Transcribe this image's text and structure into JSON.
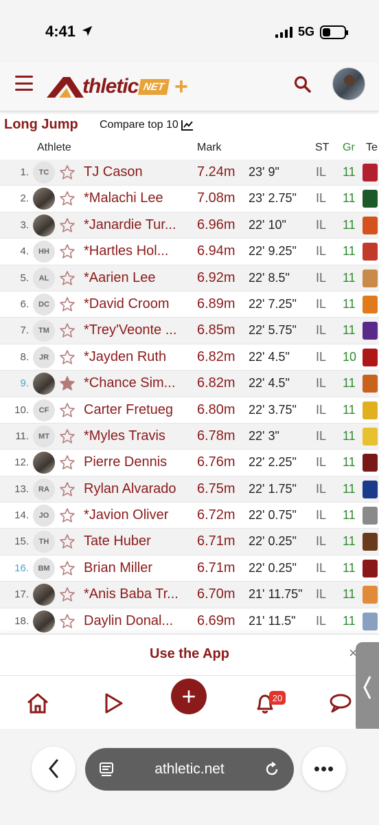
{
  "status_bar": {
    "time": "4:41",
    "network": "5G"
  },
  "header": {
    "logo_text": "thletic",
    "logo_badge": "NET"
  },
  "event": {
    "title": "Long Jump",
    "compare_label": "Compare top 10"
  },
  "columns": {
    "athlete": "Athlete",
    "mark": "Mark",
    "state": "ST",
    "grade": "Gr",
    "team": "Te"
  },
  "rows": [
    {
      "rank": "1.",
      "initials": "TC",
      "name": "TJ Cason",
      "mark": "7.24m",
      "imperial": "23' 9\"",
      "state": "IL",
      "grade": "11",
      "photo": false,
      "starred": false,
      "rank_blue": false,
      "team_color": "#b22030"
    },
    {
      "rank": "2.",
      "initials": "",
      "name": "*Malachi Lee",
      "mark": "7.08m",
      "imperial": "23' 2.75\"",
      "state": "IL",
      "grade": "11",
      "photo": true,
      "starred": false,
      "rank_blue": false,
      "team_color": "#1d5a2a"
    },
    {
      "rank": "3.",
      "initials": "",
      "name": "*Janardie Tur...",
      "mark": "6.96m",
      "imperial": "22' 10\"",
      "state": "IL",
      "grade": "11",
      "photo": true,
      "starred": false,
      "rank_blue": false,
      "team_color": "#d4521c"
    },
    {
      "rank": "4.",
      "initials": "HH",
      "name": "*Hartles Hol...",
      "mark": "6.94m",
      "imperial": "22' 9.25\"",
      "state": "IL",
      "grade": "11",
      "photo": false,
      "starred": false,
      "rank_blue": false,
      "team_color": "#c23a2a"
    },
    {
      "rank": "5.",
      "initials": "AL",
      "name": "*Aarien Lee",
      "mark": "6.92m",
      "imperial": "22' 8.5\"",
      "state": "IL",
      "grade": "11",
      "photo": false,
      "starred": false,
      "rank_blue": false,
      "team_color": "#c98a4a"
    },
    {
      "rank": "6.",
      "initials": "DC",
      "name": "*David Croom",
      "mark": "6.89m",
      "imperial": "22' 7.25\"",
      "state": "IL",
      "grade": "11",
      "photo": false,
      "starred": false,
      "rank_blue": false,
      "team_color": "#e07a1c"
    },
    {
      "rank": "7.",
      "initials": "TM",
      "name": "*Trey'Veonte ...",
      "mark": "6.85m",
      "imperial": "22' 5.75\"",
      "state": "IL",
      "grade": "11",
      "photo": false,
      "starred": false,
      "rank_blue": false,
      "team_color": "#5a2a8a"
    },
    {
      "rank": "8.",
      "initials": "JR",
      "name": "*Jayden Ruth",
      "mark": "6.82m",
      "imperial": "22' 4.5\"",
      "state": "IL",
      "grade": "10",
      "photo": false,
      "starred": false,
      "rank_blue": false,
      "team_color": "#b01818"
    },
    {
      "rank": "9.",
      "initials": "",
      "name": "*Chance Sim...",
      "mark": "6.82m",
      "imperial": "22' 4.5\"",
      "state": "IL",
      "grade": "11",
      "photo": true,
      "starred": true,
      "rank_blue": true,
      "team_color": "#c8621c"
    },
    {
      "rank": "10.",
      "initials": "CF",
      "name": "Carter Fretueg",
      "mark": "6.80m",
      "imperial": "22' 3.75\"",
      "state": "IL",
      "grade": "11",
      "photo": false,
      "starred": false,
      "rank_blue": false,
      "team_color": "#e0b020"
    },
    {
      "rank": "11.",
      "initials": "MT",
      "name": "*Myles Travis",
      "mark": "6.78m",
      "imperial": "22' 3\"",
      "state": "IL",
      "grade": "11",
      "photo": false,
      "starred": false,
      "rank_blue": false,
      "team_color": "#e8c030"
    },
    {
      "rank": "12.",
      "initials": "",
      "name": "Pierre Dennis",
      "mark": "6.76m",
      "imperial": "22' 2.25\"",
      "state": "IL",
      "grade": "11",
      "photo": true,
      "starred": false,
      "rank_blue": false,
      "team_color": "#7a1818"
    },
    {
      "rank": "13.",
      "initials": "RA",
      "name": "Rylan Alvarado",
      "mark": "6.75m",
      "imperial": "22' 1.75\"",
      "state": "IL",
      "grade": "11",
      "photo": false,
      "starred": false,
      "rank_blue": false,
      "team_color": "#1c3a8a"
    },
    {
      "rank": "14.",
      "initials": "JO",
      "name": "*Javion Oliver",
      "mark": "6.72m",
      "imperial": "22' 0.75\"",
      "state": "IL",
      "grade": "11",
      "photo": false,
      "starred": false,
      "rank_blue": false,
      "team_color": "#8a8a8a"
    },
    {
      "rank": "15.",
      "initials": "TH",
      "name": "Tate Huber",
      "mark": "6.71m",
      "imperial": "22' 0.25\"",
      "state": "IL",
      "grade": "11",
      "photo": false,
      "starred": false,
      "rank_blue": false,
      "team_color": "#6a3a1c"
    },
    {
      "rank": "16.",
      "initials": "BM",
      "name": "Brian Miller",
      "mark": "6.71m",
      "imperial": "22' 0.25\"",
      "state": "IL",
      "grade": "11",
      "photo": false,
      "starred": false,
      "rank_blue": true,
      "team_color": "#8a1818"
    },
    {
      "rank": "17.",
      "initials": "",
      "name": "*Anis Baba Tr...",
      "mark": "6.70m",
      "imperial": "21' 11.75\"",
      "state": "IL",
      "grade": "11",
      "photo": true,
      "starred": false,
      "rank_blue": false,
      "team_color": "#e08a3a"
    },
    {
      "rank": "18.",
      "initials": "",
      "name": "Daylin Donal...",
      "mark": "6.69m",
      "imperial": "21' 11.5\"",
      "state": "IL",
      "grade": "11",
      "photo": true,
      "starred": false,
      "rank_blue": false,
      "team_color": "#8aa0c0"
    }
  ],
  "app_banner": {
    "label": "Use the App",
    "close": "×"
  },
  "bottom_nav": {
    "notification_count": "20"
  },
  "browser": {
    "url": "athletic.net"
  },
  "colors": {
    "brand": "#8b1a1a",
    "accent": "#e8a23a",
    "grade": "#2e8b2e",
    "rank_highlight": "#4aa3c8"
  },
  "icons": [
    "menu-icon",
    "search-icon",
    "star-icon",
    "home-icon",
    "play-icon",
    "plus-icon",
    "bell-icon",
    "chat-icon",
    "chevron-left-icon",
    "reader-icon",
    "reload-icon",
    "more-icon",
    "chart-icon"
  ]
}
